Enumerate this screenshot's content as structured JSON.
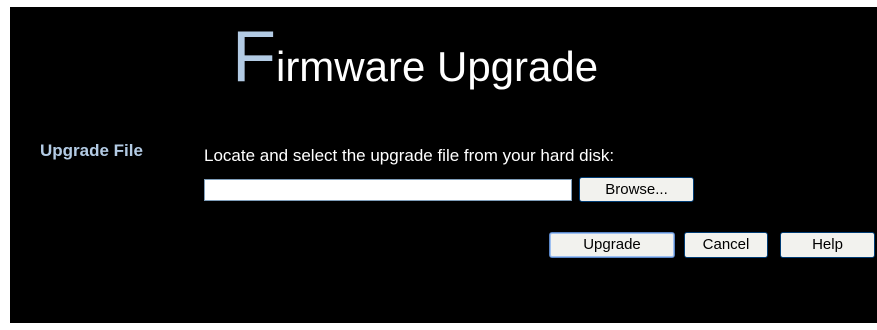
{
  "page": {
    "title_initial": "F",
    "title_rest": "irmware Upgrade"
  },
  "upgrade_file": {
    "label": "Upgrade File",
    "instruction": "Locate and select the upgrade file from your hard disk:",
    "file_value": "",
    "browse_label": "Browse..."
  },
  "actions": {
    "upgrade_label": "Upgrade",
    "cancel_label": "Cancel",
    "help_label": "Help"
  },
  "colors": {
    "background": "#000000",
    "accent": "#b3cbe4",
    "text": "#ffffff"
  }
}
